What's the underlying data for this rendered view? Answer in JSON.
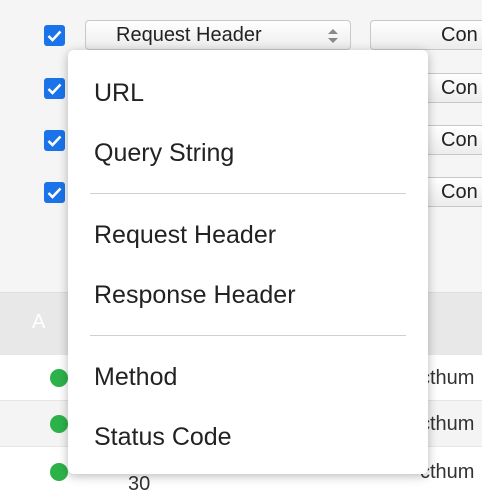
{
  "rules": [
    {
      "checked": true,
      "condition_text": "Con"
    },
    {
      "checked": true,
      "condition_text": "Con"
    },
    {
      "checked": true,
      "condition_text": "Con"
    },
    {
      "checked": true,
      "condition_text": "Con"
    }
  ],
  "field_select": {
    "selected": "Request Header"
  },
  "table": {
    "header_partial": "A",
    "rows": [
      {
        "status": "ok",
        "url_partial": "cthum"
      },
      {
        "status": "ok",
        "url_partial": "cthum"
      },
      {
        "status": "ok",
        "code_partial": "30",
        "url_partial": "cthum"
      }
    ]
  },
  "dropdown": {
    "groups": [
      [
        "URL",
        "Query String"
      ],
      [
        "Request Header",
        "Response Header"
      ],
      [
        "Method",
        "Status Code"
      ]
    ]
  },
  "colors": {
    "checkbox": "#1a73e8",
    "status_ok": "#2db24a"
  }
}
